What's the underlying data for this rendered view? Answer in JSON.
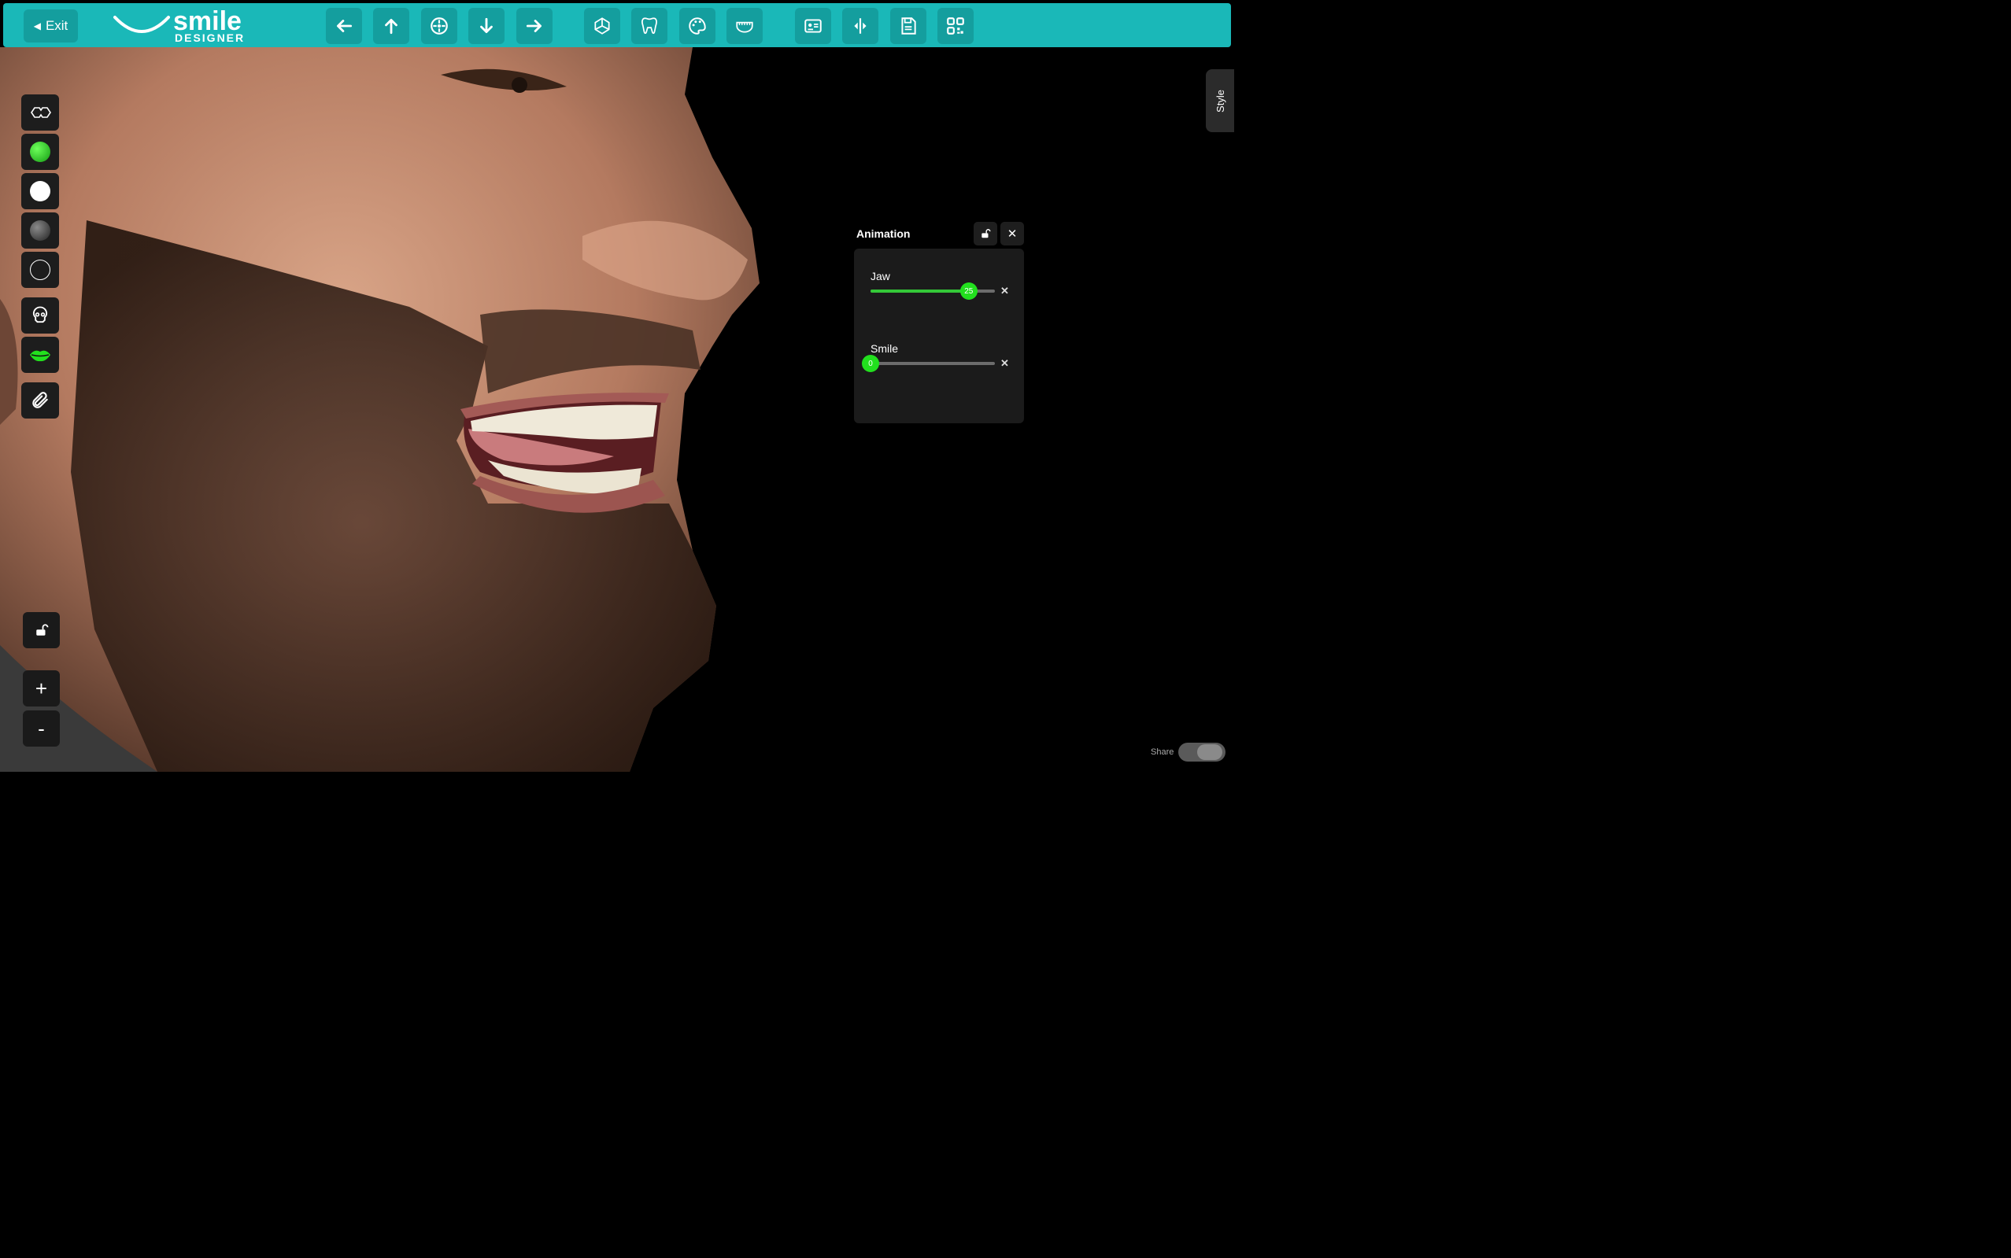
{
  "toolbar": {
    "exit_label": "Exit",
    "logo_word": "smile",
    "logo_sub": "DESIGNER",
    "buttons": [
      {
        "name": "arrow-left"
      },
      {
        "name": "arrow-up"
      },
      {
        "name": "center"
      },
      {
        "name": "arrow-down"
      },
      {
        "name": "arrow-right"
      },
      {
        "name": "3d-axes"
      },
      {
        "name": "tooth"
      },
      {
        "name": "palette"
      },
      {
        "name": "jaw"
      },
      {
        "name": "patient-card"
      },
      {
        "name": "split-view"
      },
      {
        "name": "save"
      },
      {
        "name": "qr-code"
      }
    ]
  },
  "side_tab": {
    "label": "Style"
  },
  "animation": {
    "title": "Animation",
    "sliders": [
      {
        "label": "Jaw",
        "value": "25",
        "fraction": 0.79
      },
      {
        "label": "Smile",
        "value": "0",
        "fraction": 0.0
      }
    ]
  },
  "zoom": {
    "in_label": "+",
    "out_label": "-"
  },
  "share": {
    "label": "Share"
  },
  "colors": {
    "toolbar": "#1ab8b8",
    "accent": "#22e01e"
  }
}
